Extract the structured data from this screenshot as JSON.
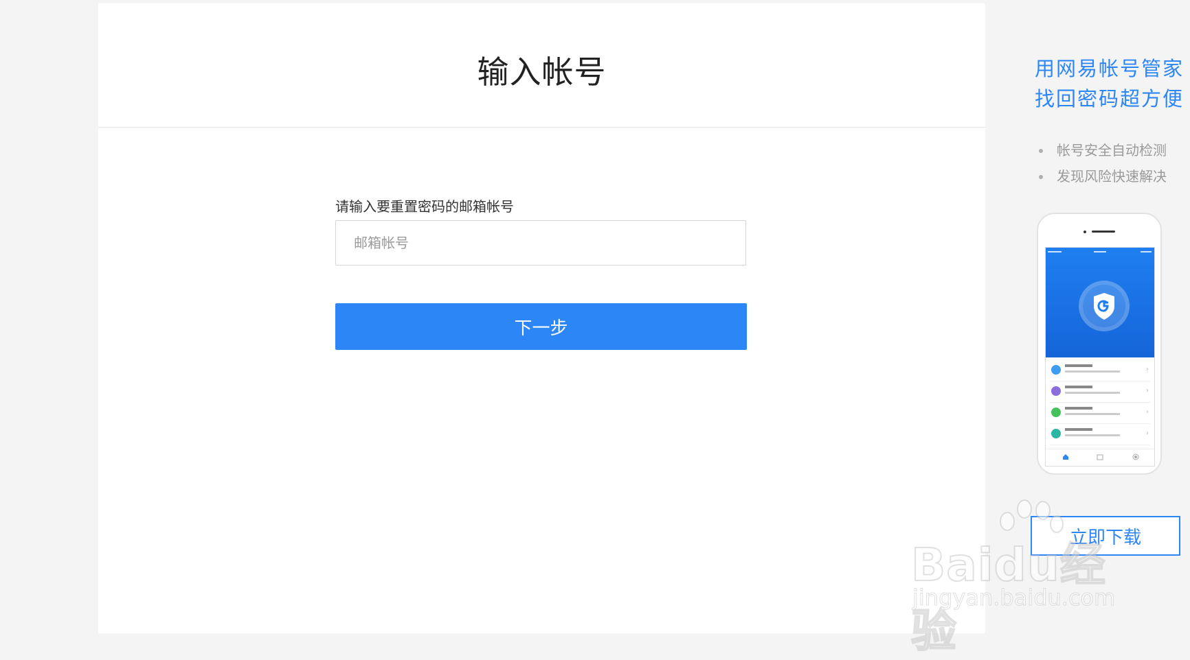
{
  "main": {
    "title": "输入帐号",
    "field_label": "请输入要重置密码的邮箱帐号",
    "email_input": {
      "value": "",
      "placeholder": "邮箱帐号"
    },
    "next_button": "下一步"
  },
  "promo": {
    "title_line1": "用网易帐号管家",
    "title_line2": "找回密码超方便",
    "features": [
      "帐号安全自动检测",
      "发现风险快速解决"
    ],
    "download_button": "立即下载"
  },
  "watermark": {
    "main": "Baidu经验",
    "sub": "jingyan.baidu.com"
  },
  "colors": {
    "accent": "#2d86f5",
    "page_background": "#f4f4f4"
  }
}
